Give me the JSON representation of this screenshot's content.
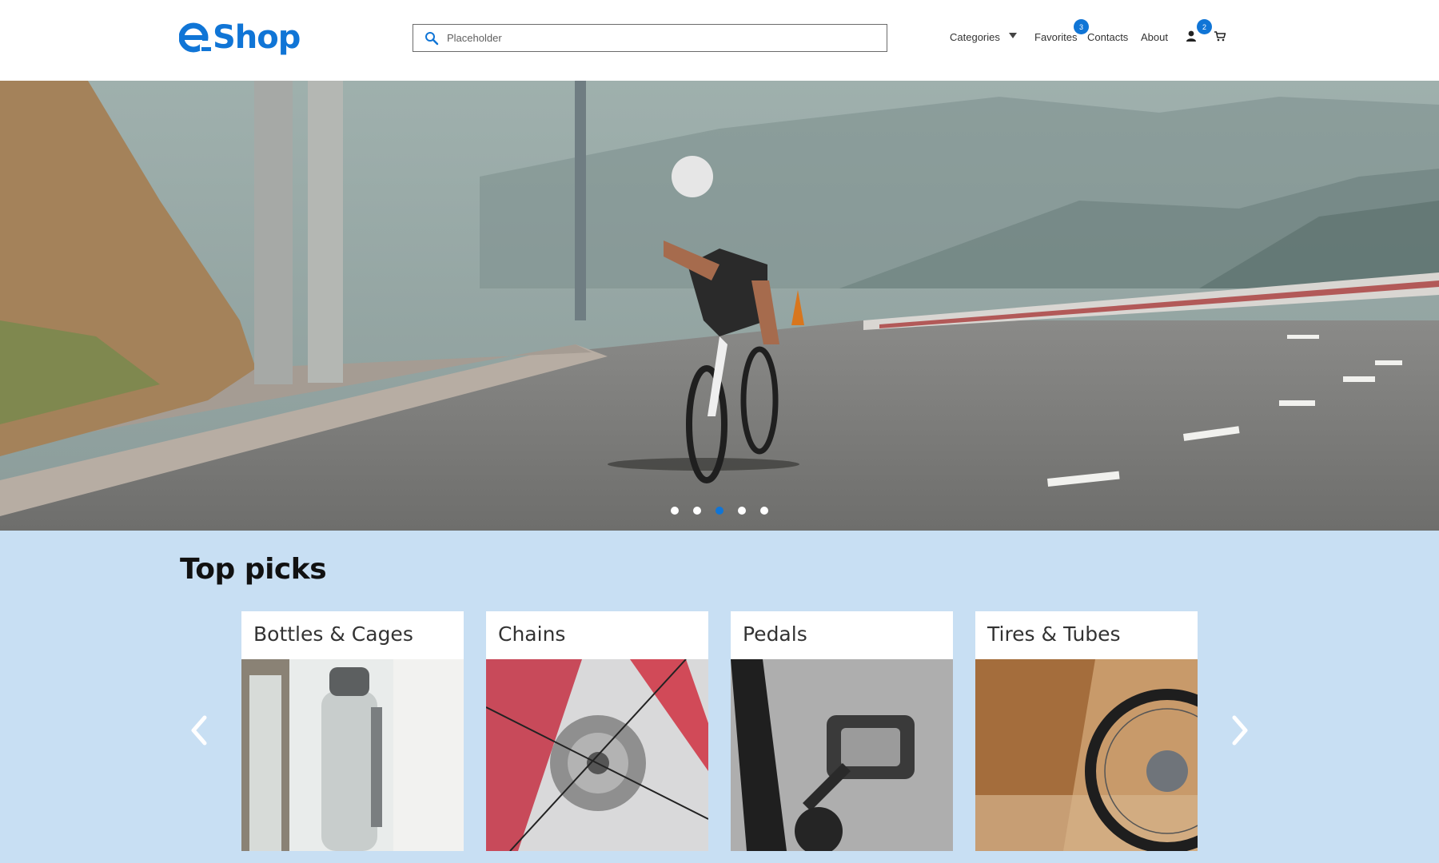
{
  "header": {
    "logo_text": "Shop",
    "search_placeholder": "Placeholder",
    "nav": {
      "categories": "Categories",
      "favorites": "Favorites",
      "favorites_count": "3",
      "contacts": "Contacts",
      "about": "About",
      "cart_count": "2"
    },
    "icons": [
      "e-logo-icon",
      "search-icon",
      "chevron-down-icon",
      "user-icon",
      "cart-icon"
    ]
  },
  "hero": {
    "slides_total": 5,
    "active_slide": 3
  },
  "top_picks": {
    "title": "Top picks",
    "items": [
      {
        "label": "Bottles & Cages"
      },
      {
        "label": "Chains"
      },
      {
        "label": "Pedals"
      },
      {
        "label": "Tires & Tubes"
      }
    ]
  },
  "colors": {
    "accent": "#1075d6",
    "section_bg": "#c8dff3"
  }
}
